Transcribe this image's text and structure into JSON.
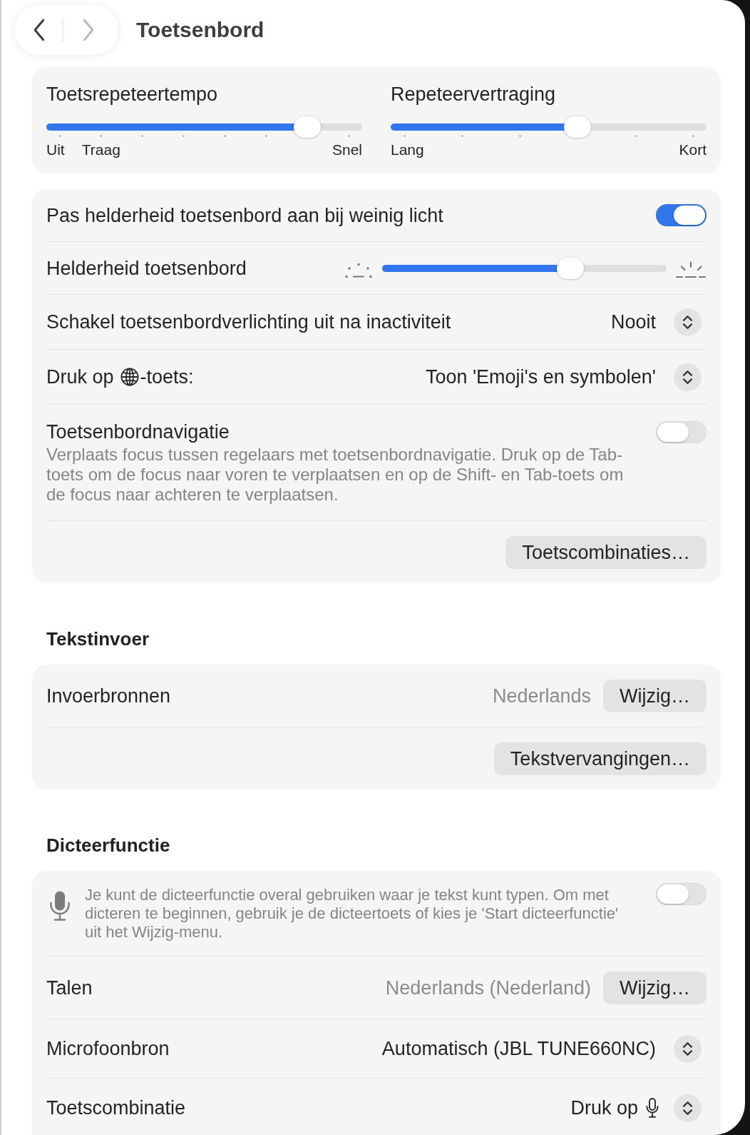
{
  "nav": {
    "back": {
      "disabled": false
    },
    "forward": {
      "disabled": true
    }
  },
  "title": "Toetsenbord",
  "groups": [
    {
      "rows": [
        {
          "kind": "sliders",
          "sliders": [
            {
              "label": "Toetsrepeteertempo",
              "level": 0.857,
              "tick_labels": [
                "Uit",
                "Traag",
                "Snel"
              ]
            },
            {
              "label": "Repeteervertraging",
              "level": 0.6,
              "tick_labels": [
                "Lang",
                "Kort"
              ]
            }
          ]
        }
      ]
    },
    {
      "rows": [
        {
          "kind": "toggle",
          "label": "Pas helderheid toetsenbord aan bij weinig licht",
          "on": true
        },
        {
          "kind": "slider",
          "label": "Helderheid toetsenbord",
          "level": 0.68
        },
        {
          "kind": "popup",
          "label": "Schakel toetsenbordverlichting uit na inactiviteit",
          "value": "Nooit"
        },
        {
          "kind": "popup",
          "label": [
            {
              "kind": "text",
              "text": "Druk op"
            },
            {
              "kind": "icon"
            },
            {
              "kind": "text",
              "text": "-toets:"
            }
          ],
          "value": "Toon 'Emoji's en symbolen'"
        },
        {
          "kind": "toggle",
          "label": "Toetsenbordnavigatie",
          "description": "Verplaats focus tussen regelaars met toetsenbordnavigatie. Druk op de Tab-toets om de focus naar voren te verplaatsen en op de Shift- en Tab-toets om de focus naar achteren te verplaatsen.",
          "on": false
        },
        {
          "kind": "button",
          "button": "Toetscombinaties…"
        }
      ]
    },
    {
      "heading": "Tekstinvoer",
      "rows": [
        {
          "kind": "value_button",
          "label": "Invoerbronnen",
          "value": "Nederlands",
          "button": "Wijzig…"
        },
        {
          "kind": "button",
          "button": "Tekstvervangingen…"
        }
      ]
    },
    {
      "heading": "Dicteerfunctie",
      "rows": [
        {
          "kind": "info_toggle",
          "text": "Je kunt de dicteerfunctie overal gebruiken waar je tekst kunt typen. Om met dicteren te beginnen, gebruik je de dicteertoets of kies je 'Start dicteerfunctie' uit het Wijzig-menu.",
          "on": false
        },
        {
          "kind": "value_button",
          "label": "Talen",
          "value": "Nederlands (Nederland)",
          "button": "Wijzig…"
        },
        {
          "kind": "popup",
          "label": "Microfoonbron",
          "value": "Automatisch (JBL TUNE660NC)"
        },
        {
          "kind": "popup",
          "label": "Toetscombinatie",
          "value": [
            {
              "kind": "text",
              "text": "Druk op"
            },
            {
              "kind": "icon"
            }
          ]
        }
      ]
    }
  ]
}
